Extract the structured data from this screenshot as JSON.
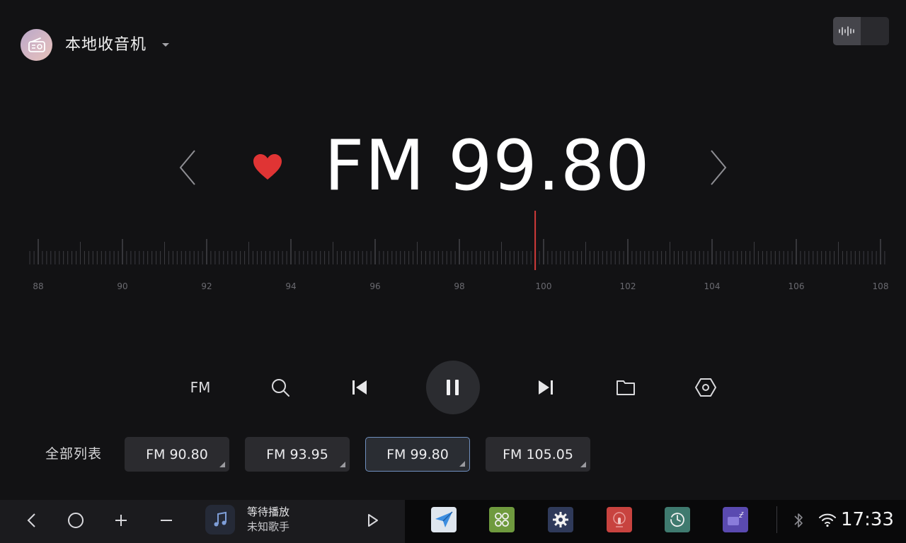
{
  "header": {
    "source_title": "本地收音机",
    "source_icon": "radio-icon",
    "dropdown_icon": "caret-down-icon",
    "wave_toggle_icon": "waveform-icon"
  },
  "tuner": {
    "band": "FM",
    "frequency": "FM 99.80",
    "favorite": true,
    "favorite_color": "#e03434",
    "prev_icon": "chevron-left-icon",
    "next_icon": "chevron-right-icon"
  },
  "dial": {
    "min": 88,
    "max": 108,
    "current": 99.8,
    "labels": [
      "88",
      "90",
      "92",
      "94",
      "96",
      "98",
      "100",
      "102",
      "104",
      "106",
      "108"
    ],
    "indicator_color": "#d23a3a"
  },
  "controls": {
    "band_label": "FM",
    "search_icon": "search-icon",
    "prev_icon": "skip-previous-icon",
    "pause_icon": "pause-icon",
    "next_icon": "skip-next-icon",
    "folder_icon": "folder-icon",
    "settings_icon": "settings-hexagon-icon"
  },
  "presets": {
    "all_list_label": "全部列表",
    "items": [
      {
        "label": "FM 90.80",
        "active": false
      },
      {
        "label": "FM 93.95",
        "active": false
      },
      {
        "label": "FM 99.80",
        "active": true
      },
      {
        "label": "FM 105.05",
        "active": false
      }
    ]
  },
  "bottom_bar": {
    "back_icon": "back-icon",
    "home_icon": "home-icon",
    "volume_up_icon": "plus-icon",
    "volume_down_icon": "minus-icon",
    "now_playing": {
      "title": "等待播放",
      "artist": "未知歌手",
      "icon": "music-note-icon",
      "play_icon": "play-icon"
    },
    "dock": [
      {
        "name": "navigation-app",
        "icon": "send-arrow-icon",
        "color": "#dfe6ee"
      },
      {
        "name": "apps-grid",
        "icon": "grid-icon",
        "color": "#6f9a3e"
      },
      {
        "name": "settings-app",
        "icon": "gear-icon",
        "color": "#2f3a5a"
      },
      {
        "name": "voice-app",
        "icon": "microphone-icon",
        "color": "#c8433f"
      },
      {
        "name": "clock-app",
        "icon": "clock-icon",
        "color": "#3f7a6f"
      },
      {
        "name": "sleep-app",
        "icon": "sleep-icon",
        "color": "#5a4ab0"
      }
    ],
    "status": {
      "bluetooth_icon": "bluetooth-icon",
      "wifi_icon": "wifi-icon",
      "time": "17:33"
    }
  }
}
